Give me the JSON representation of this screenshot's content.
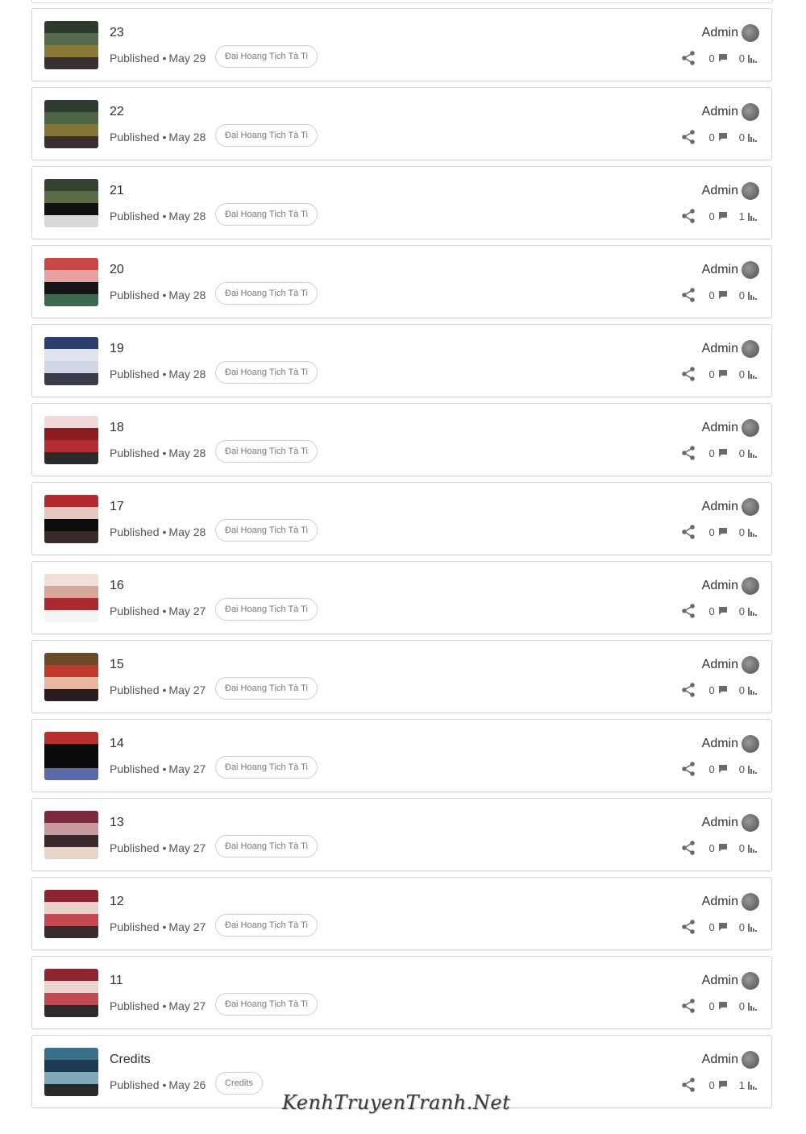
{
  "colors": {
    "card_border": "#d5d5d5",
    "text": "#303030",
    "muted_text": "#555555",
    "tag_text": "#777777",
    "icon": "#6a6a6a"
  },
  "posts": [
    {
      "title": "23",
      "status": "Published",
      "separator": "•",
      "date": "May 29",
      "tag": "Đại Hoang Tịch Tà Ti",
      "author": "Admin",
      "comments": "0",
      "views": "0",
      "icons": {
        "share": "share-icon",
        "comments": "comment-icon",
        "views": "bar-chart-icon"
      },
      "thumb_colors": [
        "#2e3a2c",
        "#556b4e",
        "#8a7a3a",
        "#3b3030"
      ]
    },
    {
      "title": "22",
      "status": "Published",
      "separator": "•",
      "date": "May 28",
      "tag": "Đại Hoang Tịch Tà Ti",
      "author": "Admin",
      "comments": "0",
      "views": "0",
      "icons": {
        "share": "share-icon",
        "comments": "comment-icon",
        "views": "bar-chart-icon"
      },
      "thumb_colors": [
        "#2f3b2e",
        "#4e6447",
        "#847538",
        "#3a2f2f"
      ]
    },
    {
      "title": "21",
      "status": "Published",
      "separator": "•",
      "date": "May 28",
      "tag": "Đại Hoang Tịch Tà Ti",
      "author": "Admin",
      "comments": "0",
      "views": "1",
      "icons": {
        "share": "share-icon",
        "comments": "comment-icon",
        "views": "bar-chart-icon"
      },
      "thumb_colors": [
        "#34432f",
        "#5b6d47",
        "#111111",
        "#d8d8d8"
      ]
    },
    {
      "title": "20",
      "status": "Published",
      "separator": "•",
      "date": "May 28",
      "tag": "Đại Hoang Tịch Tà Ti",
      "author": "Admin",
      "comments": "0",
      "views": "0",
      "icons": {
        "share": "share-icon",
        "comments": "comment-icon",
        "views": "bar-chart-icon"
      },
      "thumb_colors": [
        "#c84848",
        "#e7a0a0",
        "#161616",
        "#3b6a4d"
      ]
    },
    {
      "title": "19",
      "status": "Published",
      "separator": "•",
      "date": "May 28",
      "tag": "Đại Hoang Tịch Tà Ti",
      "author": "Admin",
      "comments": "0",
      "views": "0",
      "icons": {
        "share": "share-icon",
        "comments": "comment-icon",
        "views": "bar-chart-icon"
      },
      "thumb_colors": [
        "#2a3f6e",
        "#dfe3ee",
        "#cfd6e4",
        "#3b3b4a"
      ]
    },
    {
      "title": "18",
      "status": "Published",
      "separator": "•",
      "date": "May 28",
      "tag": "Đại Hoang Tịch Tà Ti",
      "author": "Admin",
      "comments": "0",
      "views": "0",
      "icons": {
        "share": "share-icon",
        "comments": "comment-icon",
        "views": "bar-chart-icon"
      },
      "thumb_colors": [
        "#efd9d9",
        "#8a1c22",
        "#b32d32",
        "#2b2b2b"
      ]
    },
    {
      "title": "17",
      "status": "Published",
      "separator": "•",
      "date": "May 28",
      "tag": "Đại Hoang Tịch Tà Ti",
      "author": "Admin",
      "comments": "0",
      "views": "0",
      "icons": {
        "share": "share-icon",
        "comments": "comment-icon",
        "views": "bar-chart-icon"
      },
      "thumb_colors": [
        "#b02a30",
        "#e6c7c0",
        "#0d0d0d",
        "#3a2a2a"
      ]
    },
    {
      "title": "16",
      "status": "Published",
      "separator": "•",
      "date": "May 27",
      "tag": "Đại Hoang Tịch Tà Ti",
      "author": "Admin",
      "comments": "0",
      "views": "0",
      "icons": {
        "share": "share-icon",
        "comments": "comment-icon",
        "views": "bar-chart-icon"
      },
      "thumb_colors": [
        "#f0dfd6",
        "#d8a79a",
        "#a82a30",
        "#f4f4f4"
      ]
    },
    {
      "title": "15",
      "status": "Published",
      "separator": "•",
      "date": "May 27",
      "tag": "Đại Hoang Tịch Tà Ti",
      "author": "Admin",
      "comments": "0",
      "views": "0",
      "icons": {
        "share": "share-icon",
        "comments": "comment-icon",
        "views": "bar-chart-icon"
      },
      "thumb_colors": [
        "#6b4a2a",
        "#c0392b",
        "#e8b7a0",
        "#2b1d1d"
      ]
    },
    {
      "title": "14",
      "status": "Published",
      "separator": "•",
      "date": "May 27",
      "tag": "Đại Hoang Tịch Tà Ti",
      "author": "Admin",
      "comments": "0",
      "views": "0",
      "icons": {
        "share": "share-icon",
        "comments": "comment-icon",
        "views": "bar-chart-icon"
      },
      "thumb_colors": [
        "#b5302e",
        "#0b0b0b",
        "#0b0b0b",
        "#5a6aa8"
      ]
    },
    {
      "title": "13",
      "status": "Published",
      "separator": "•",
      "date": "May 27",
      "tag": "Đại Hoang Tịch Tà Ti",
      "author": "Admin",
      "comments": "0",
      "views": "0",
      "icons": {
        "share": "share-icon",
        "comments": "comment-icon",
        "views": "bar-chart-icon"
      },
      "thumb_colors": [
        "#7a2a3a",
        "#c89aa0",
        "#3a2a2e",
        "#e6d6c8"
      ]
    },
    {
      "title": "12",
      "status": "Published",
      "separator": "•",
      "date": "May 27",
      "tag": "Đại Hoang Tịch Tà Ti",
      "author": "Admin",
      "comments": "0",
      "views": "0",
      "icons": {
        "share": "share-icon",
        "comments": "comment-icon",
        "views": "bar-chart-icon"
      },
      "thumb_colors": [
        "#8a2530",
        "#e9d2cc",
        "#c24a50",
        "#3a2b2e"
      ]
    },
    {
      "title": "11",
      "status": "Published",
      "separator": "•",
      "date": "May 27",
      "tag": "Đại Hoang Tịch Tà Ti",
      "author": "Admin",
      "comments": "0",
      "views": "0",
      "icons": {
        "share": "share-icon",
        "comments": "comment-icon",
        "views": "bar-chart-icon"
      },
      "thumb_colors": [
        "#8e2631",
        "#ead4cf",
        "#c04b52",
        "#2f2a2d"
      ]
    },
    {
      "title": "Credits",
      "status": "Published",
      "separator": "•",
      "date": "May 26",
      "tag": "Credits",
      "author": "Admin",
      "comments": "0",
      "views": "1",
      "icons": {
        "share": "share-icon",
        "comments": "comment-icon",
        "views": "bar-chart-icon"
      },
      "thumb_colors": [
        "#3e6f8a",
        "#1d3a52",
        "#7fa9b8",
        "#2a2a2a"
      ]
    }
  ],
  "watermark": {
    "text": "KenhTruyenTranh.Net"
  }
}
